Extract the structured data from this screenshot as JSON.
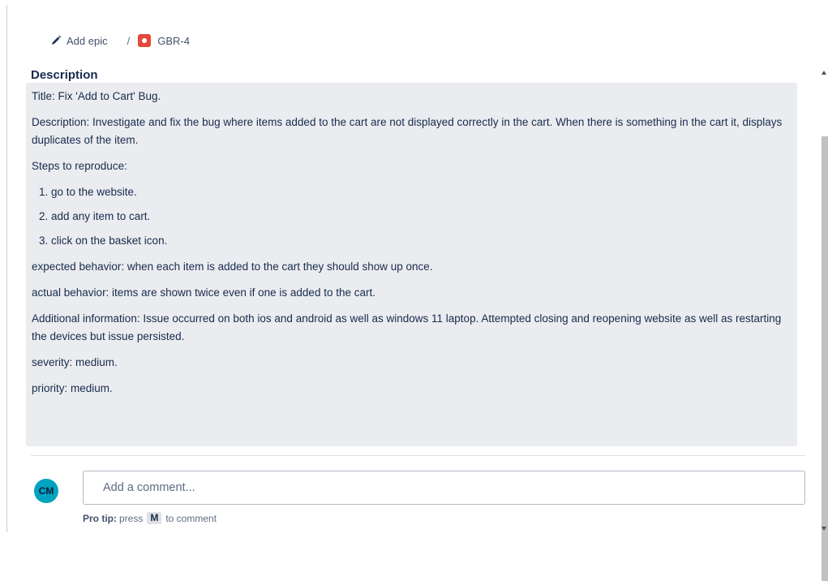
{
  "breadcrumb": {
    "add_epic": "Add epic",
    "separator": "/",
    "issue_key": "GBR-4",
    "pencil_icon": "pencil-icon",
    "bug_icon": "bug-icon"
  },
  "description": {
    "heading": "Description",
    "title_line": "Title:  Fix 'Add to Cart' Bug.",
    "description_line": "Description: Investigate and fix the bug where items added to the cart are not displayed correctly in the cart. When there is something in the cart it, displays duplicates of the item.",
    "steps_heading": "Steps to reproduce:",
    "steps": [
      "go to the website.",
      "add any item to cart.",
      "click on the basket icon."
    ],
    "expected": "expected behavior: when each item is added to the cart they should show up once.",
    "actual": "actual behavior: items are shown twice even if one is added to the cart.",
    "additional": "Additional information: Issue occurred on both ios and android as well as windows 11 laptop. Attempted closing and reopening website as well as restarting the devices but issue persisted.",
    "severity": "severity: medium.",
    "priority": "priority: medium."
  },
  "comment": {
    "avatar_initials": "CM",
    "placeholder": "Add a comment...",
    "pro_tip_label": "Pro tip:",
    "pro_tip_press": "press",
    "pro_tip_key": "M",
    "pro_tip_suffix": "to comment"
  },
  "colors": {
    "bug": "#e5493a",
    "avatar": "#00a3bf",
    "description_bg": "#ebecf0"
  }
}
